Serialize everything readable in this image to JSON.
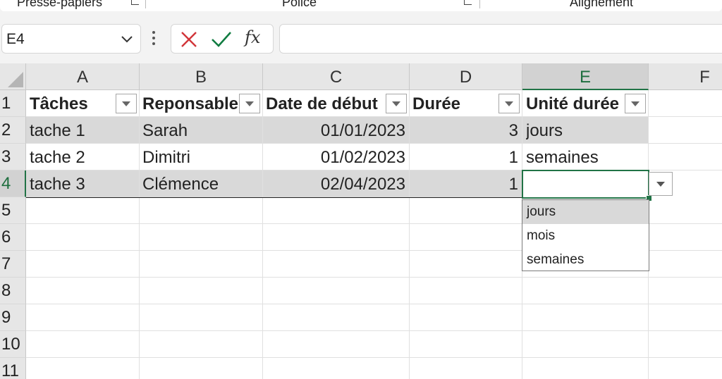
{
  "ribbon": {
    "groups": [
      "Presse-papiers",
      "Police",
      "Alignement"
    ]
  },
  "formula_bar": {
    "name_box": "E4",
    "fx_label": "fx",
    "formula": ""
  },
  "columns": [
    "A",
    "B",
    "C",
    "D",
    "E",
    "F"
  ],
  "rows": [
    "1",
    "2",
    "3",
    "4",
    "5",
    "6",
    "7",
    "8",
    "9",
    "10",
    "11"
  ],
  "table": {
    "headers": [
      "Tâches",
      "Reponsable",
      "Date de début",
      "Durée",
      "Unité durée"
    ],
    "data": [
      [
        "tache 1",
        "Sarah",
        "01/01/2023",
        "3",
        "jours"
      ],
      [
        "tache 2",
        "Dimitri",
        "01/02/2023",
        "1",
        "semaines"
      ],
      [
        "tache 3",
        "Clémence",
        "02/04/2023",
        "1",
        ""
      ]
    ]
  },
  "active_cell": "E4",
  "dropdown": {
    "options": [
      "jours",
      "mois",
      "semaines"
    ],
    "highlighted": "jours"
  },
  "colors": {
    "accent": "#217346",
    "cancel": "#d13438",
    "enter": "#107c41",
    "banded_row": "#d9d9d9"
  }
}
